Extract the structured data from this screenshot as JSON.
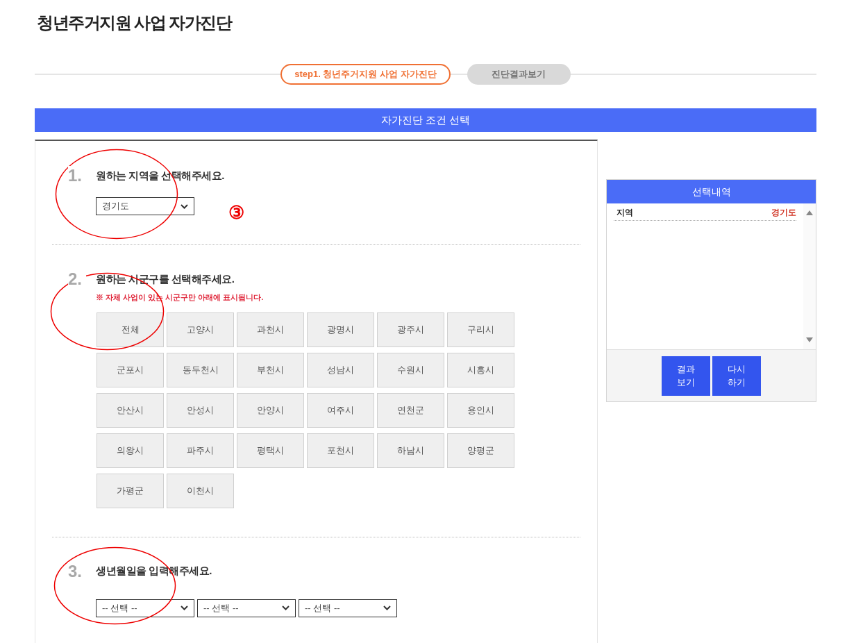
{
  "title": "청년주거지원 사업 자가진단",
  "steps": [
    {
      "label": "step1. 청년주거지원 사업 자가진단",
      "selected": true
    },
    {
      "label": "진단결과보기",
      "selected": false
    }
  ],
  "section_header": "자가진단 조건 선택",
  "questions": [
    {
      "kind": "select",
      "number": "1.",
      "text": "원하는 지역을 선택해주세요.",
      "value": "경기도"
    },
    {
      "kind": "grid",
      "number": "2.",
      "text": "원하는 시군구를 선택해주세요.",
      "note": "※ 자체 사업이 있는 시군구만 아래에 표시됩니다.",
      "options": [
        {
          "label": "전체",
          "selected": false
        },
        {
          "label": "고양시",
          "selected": false
        },
        {
          "label": "과천시",
          "selected": false
        },
        {
          "label": "광명시",
          "selected": false
        },
        {
          "label": "광주시",
          "selected": false
        },
        {
          "label": "구리시",
          "selected": false
        },
        {
          "label": "군포시",
          "selected": false
        },
        {
          "label": "동두천시",
          "selected": false
        },
        {
          "label": "부천시",
          "selected": false
        },
        {
          "label": "성남시",
          "selected": false
        },
        {
          "label": "수원시",
          "selected": false
        },
        {
          "label": "시흥시",
          "selected": false
        },
        {
          "label": "안산시",
          "selected": false
        },
        {
          "label": "안성시",
          "selected": false
        },
        {
          "label": "안양시",
          "selected": false
        },
        {
          "label": "여주시",
          "selected": false
        },
        {
          "label": "연천군",
          "selected": false
        },
        {
          "label": "용인시",
          "selected": false
        },
        {
          "label": "의왕시",
          "selected": false
        },
        {
          "label": "파주시",
          "selected": false
        },
        {
          "label": "평택시",
          "selected": false
        },
        {
          "label": "포천시",
          "selected": false
        },
        {
          "label": "하남시",
          "selected": false
        },
        {
          "label": "양평군",
          "selected": false
        },
        {
          "label": "가평군",
          "selected": false
        },
        {
          "label": "이천시",
          "selected": false
        }
      ]
    },
    {
      "kind": "date",
      "number": "3.",
      "text": "생년월일을 입력해주세요.",
      "selects": [
        "-- 선택 --",
        "-- 선택 --",
        "-- 선택 --"
      ]
    }
  ],
  "summary": {
    "title": "선택내역",
    "rows": [
      {
        "label": "지역",
        "value": "경기도"
      }
    ],
    "buttons": [
      "결과\n보기",
      "다시\n하기"
    ]
  },
  "annotation_marker": "③"
}
